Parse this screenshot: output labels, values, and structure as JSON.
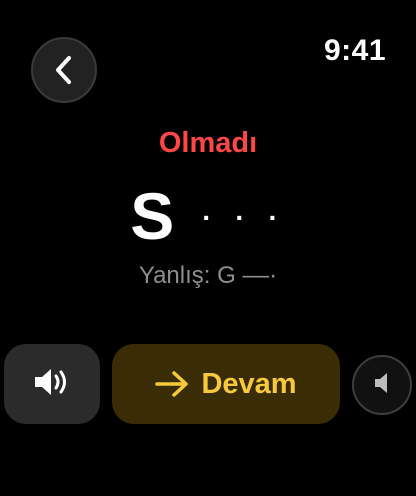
{
  "status_bar": {
    "time": "9:41"
  },
  "header": {
    "back_icon": "chevron-left-icon"
  },
  "result": {
    "title": "Olmadı",
    "title_color": "#ff4747",
    "letter": "S",
    "morse": "· · ·",
    "wrong_answer": "Yanlış: G ––·"
  },
  "actions": {
    "play_icon": "speaker-wave-icon",
    "continue_icon": "arrow-right-icon",
    "continue_label": "Devam",
    "continue_color": "#f8c93a",
    "mute_icon": "speaker-icon"
  }
}
